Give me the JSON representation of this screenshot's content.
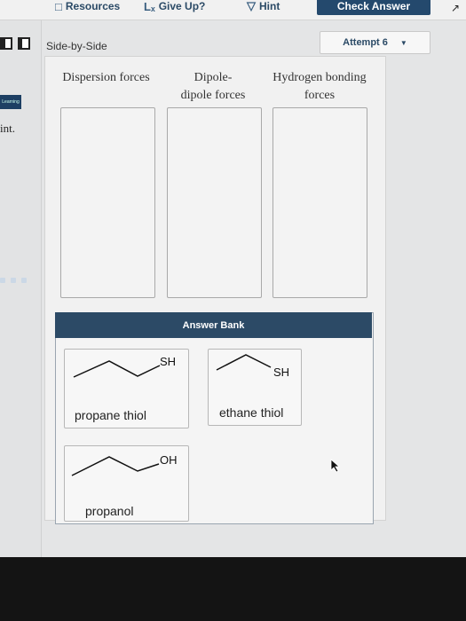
{
  "toolbar": {
    "resources_label": "Resources",
    "giveup_label": "Give Up?",
    "hint_label": "Hint",
    "check_answer_label": "Check Answer"
  },
  "view": {
    "mode_label": "Side-by-Side",
    "attempt_label": "Attempt 6"
  },
  "left_panel": {
    "badge_text": "Learning",
    "question_fragment": "int."
  },
  "categories": [
    {
      "line1": "Dispersion forces",
      "line2": ""
    },
    {
      "line1": "Dipole-",
      "line2": "dipole forces"
    },
    {
      "line1": "Hydrogen bonding",
      "line2": "forces"
    }
  ],
  "answer_bank": {
    "header": "Answer Bank",
    "items": [
      {
        "label": "propane thiol",
        "group": "SH"
      },
      {
        "label": "ethane thiol",
        "group": "SH"
      },
      {
        "label": "propanol",
        "group": "OH"
      }
    ]
  },
  "colors": {
    "header_blue": "#2c4a66",
    "check_button": "#24496d"
  }
}
